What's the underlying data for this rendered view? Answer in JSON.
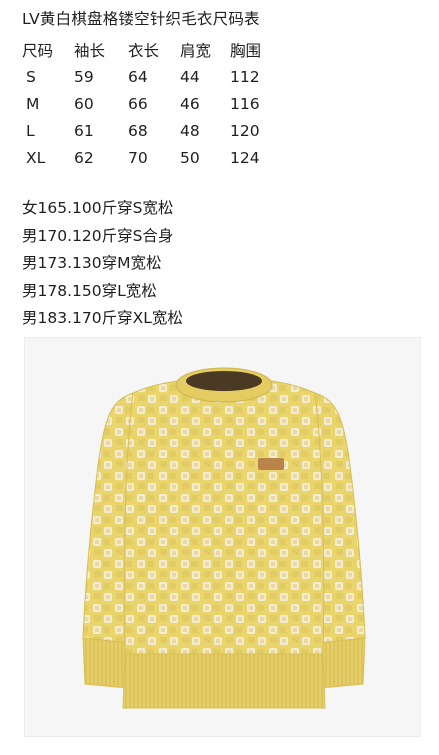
{
  "title": "LV黄白棋盘格镂空针织毛衣尺码表",
  "size_table": {
    "headers": [
      "尺码",
      "袖长",
      "衣长",
      "肩宽",
      "胸围"
    ],
    "rows": [
      [
        "S",
        "59",
        "64",
        "44",
        "112"
      ],
      [
        "M",
        "60",
        "66",
        "46",
        "116"
      ],
      [
        "L",
        "61",
        "68",
        "48",
        "120"
      ],
      [
        "XL",
        "62",
        "70",
        "50",
        "124"
      ]
    ]
  },
  "fit_notes": [
    "女165.100斤穿S宽松",
    "男170.120斤穿S合身",
    "男173.130穿M宽松",
    "男178.150穿L宽松",
    "男183.170斤穿XL宽松"
  ],
  "colors": {
    "sweater_yellow": "#e9d46a",
    "sweater_cream": "#f2ead0",
    "pattern_dark": "#c9b24a",
    "collar_brown": "#4a3a24",
    "patch_tan": "#b8844a"
  }
}
